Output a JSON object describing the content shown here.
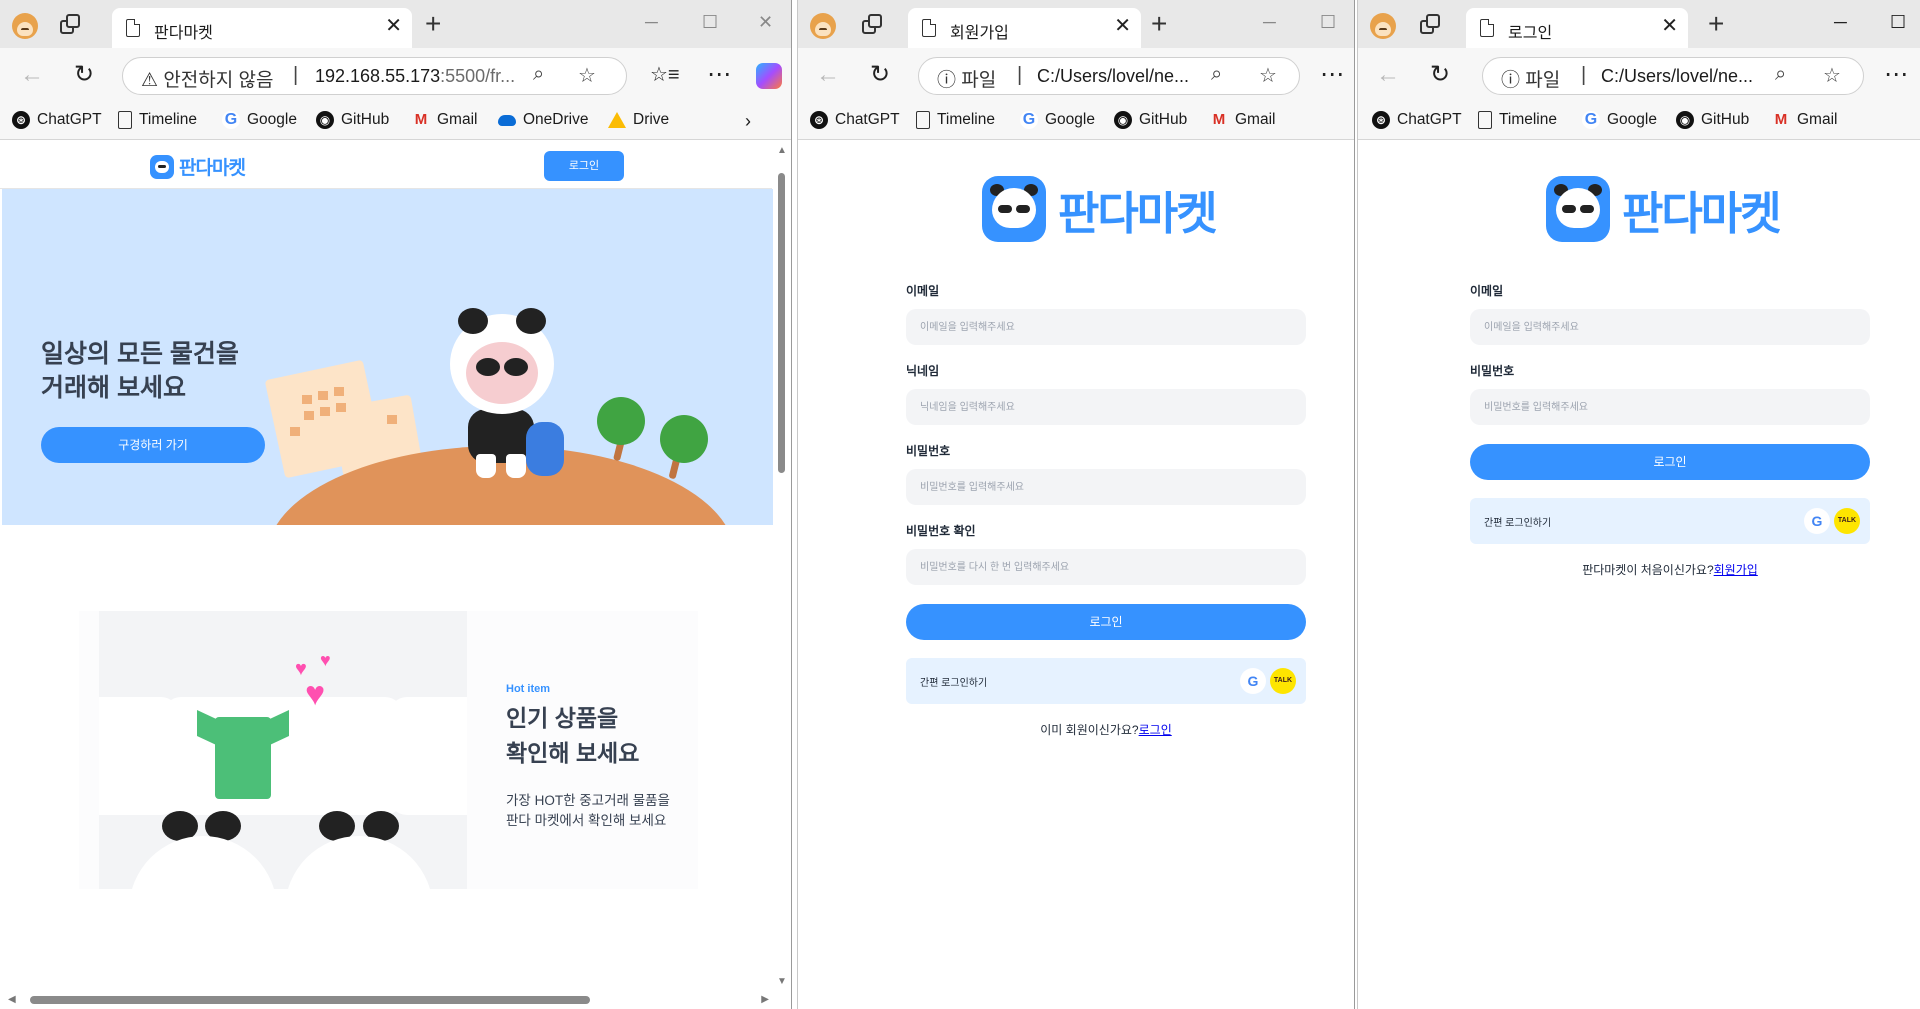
{
  "windows": {
    "market": {
      "tab_title": "판다마켓",
      "security": "안전하지 않음",
      "url_main": "192.168.55.173",
      "url_rest": ":5500/fr...",
      "bookmarks": [
        "ChatGPT",
        "Timeline",
        "Google",
        "GitHub",
        "Gmail",
        "OneDrive",
        "Drive"
      ],
      "header": {
        "logo": "판다마켓",
        "login": "로그인"
      },
      "hero": {
        "title_line1": "일상의 모든 물건을",
        "title_line2": "거래해 보세요",
        "button": "구경하러 가기"
      },
      "feature": {
        "label": "Hot item",
        "title_line1": "인기 상품을",
        "title_line2": "확인해 보세요",
        "desc_line1": "가장 HOT한 중고거래 물품을",
        "desc_line2": "판다 마켓에서 확인해 보세요"
      }
    },
    "signup": {
      "tab_title": "회원가입",
      "scheme": "파일",
      "url": "C:/Users/lovel/ne...",
      "bookmarks": [
        "ChatGPT",
        "Timeline",
        "Google",
        "GitHub",
        "Gmail"
      ],
      "logo": "판다마켓",
      "fields": [
        {
          "label": "이메일",
          "placeholder": "이메일을 입력해주세요"
        },
        {
          "label": "닉네임",
          "placeholder": "닉네임을 입력해주세요"
        },
        {
          "label": "비밀번호",
          "placeholder": "비밀번호를 입력해주세요"
        },
        {
          "label": "비밀번호 확인",
          "placeholder": "비밀번호를 다시 한 번 입력해주세요"
        }
      ],
      "submit": "로그인",
      "easy_login": "간편 로그인하기",
      "bottom_text": "이미 회원이신가요?",
      "bottom_link": "로그인"
    },
    "login": {
      "tab_title": "로그인",
      "scheme": "파일",
      "url": "C:/Users/lovel/ne...",
      "bookmarks": [
        "ChatGPT",
        "Timeline",
        "Google",
        "GitHub",
        "Gmail"
      ],
      "logo": "판다마켓",
      "fields": [
        {
          "label": "이메일",
          "placeholder": "이메일을 입력해주세요"
        },
        {
          "label": "비밀번호",
          "placeholder": "비밀번호를 입력해주세요"
        }
      ],
      "submit": "로그인",
      "easy_login": "간편 로그인하기",
      "bottom_text": "판다마켓이 처음이신가요?",
      "bottom_link": "회원가입"
    }
  },
  "icons": {
    "google": "G",
    "kakao": "TALK"
  },
  "colors": {
    "brand": "#3692ff",
    "hero_bg": "#cfe5ff",
    "input_bg": "#f3f4f6",
    "easy_bg": "#e6f2ff"
  }
}
